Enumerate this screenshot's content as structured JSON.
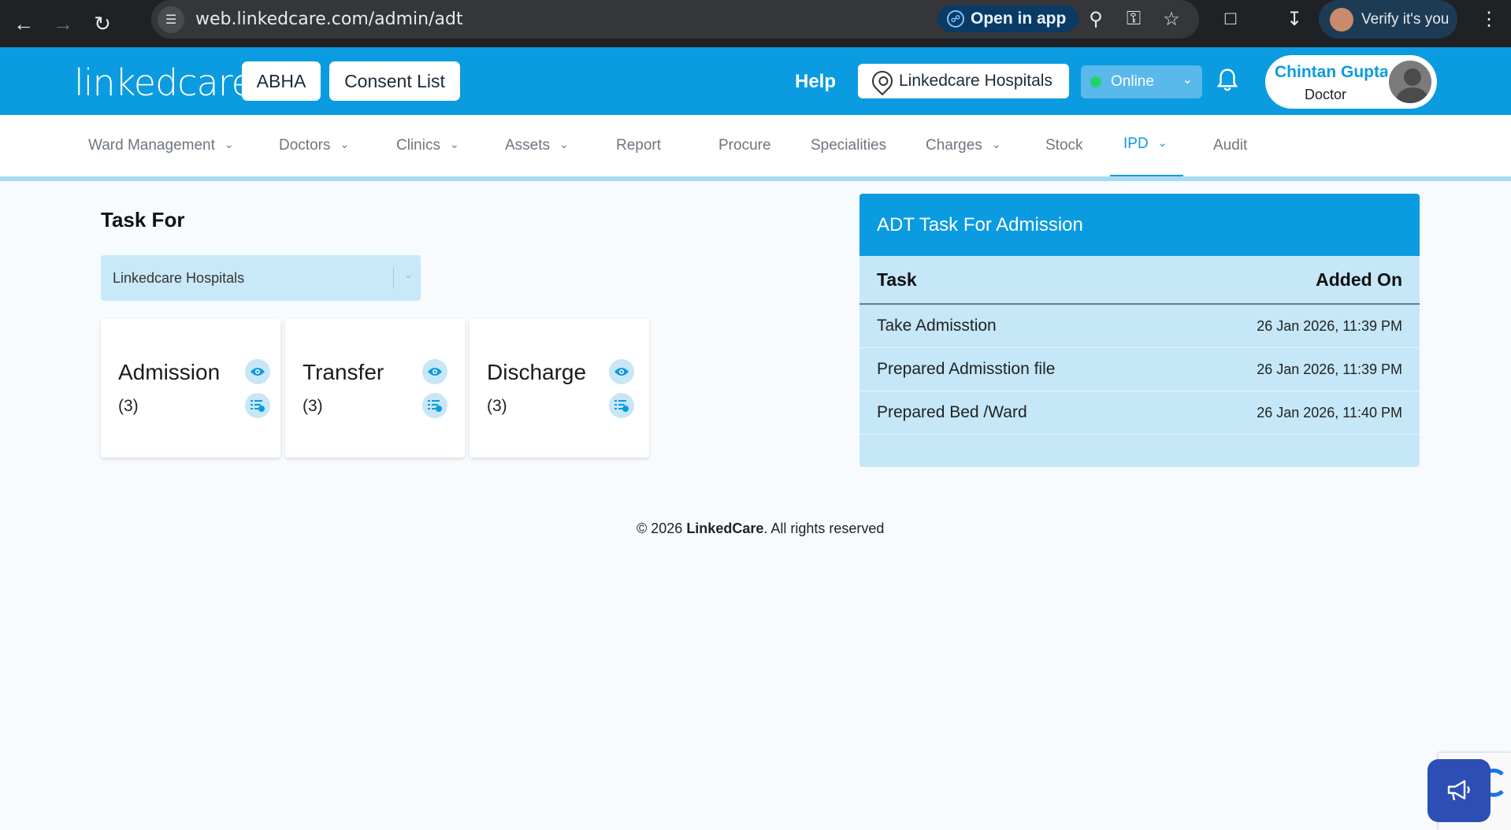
{
  "browser": {
    "url": "web.linkedcare.com/admin/adt",
    "open_in_app": "Open in app",
    "verify": "Verify it's you"
  },
  "header": {
    "logo": "linkedcare",
    "abha_button": "ABHA",
    "consent_button": "Consent List",
    "help": "Help",
    "location": "Linkedcare Hospitals",
    "status": "Online",
    "user_name": "Chintan Gupta",
    "user_role": "Doctor"
  },
  "nav": {
    "items": [
      {
        "label": "Ward Management",
        "dropdown": true
      },
      {
        "label": "Doctors",
        "dropdown": true
      },
      {
        "label": "Clinics",
        "dropdown": true
      },
      {
        "label": "Assets",
        "dropdown": true
      },
      {
        "label": "Report",
        "dropdown": false
      },
      {
        "label": "Procure",
        "dropdown": false
      },
      {
        "label": "Specialities",
        "dropdown": false
      },
      {
        "label": "Charges",
        "dropdown": true
      },
      {
        "label": "Stock",
        "dropdown": false
      },
      {
        "label": "IPD",
        "dropdown": true,
        "active": true
      },
      {
        "label": "Audit",
        "dropdown": false
      }
    ]
  },
  "task_for": {
    "title": "Task For",
    "selected": "Linkedcare Hospitals",
    "cards": [
      {
        "label": "Admission",
        "count": "(3)"
      },
      {
        "label": "Transfer",
        "count": "(3)"
      },
      {
        "label": "Discharge",
        "count": "(3)"
      }
    ]
  },
  "adt_panel": {
    "title": "ADT Task For Admission",
    "col_task": "Task",
    "col_added": "Added On",
    "rows": [
      {
        "task": "Take Admisstion",
        "added": "26 Jan 2026, 11:39 PM"
      },
      {
        "task": "Prepared Admisstion file",
        "added": "26 Jan 2026, 11:39 PM"
      },
      {
        "task": "Prepared Bed /Ward",
        "added": "26 Jan 2026, 11:40 PM"
      }
    ]
  },
  "footer": {
    "prefix": "© 2026 ",
    "brand": "LinkedCare",
    "suffix": ". All rights reserved"
  },
  "colors": {
    "primary": "#0b9be0",
    "light": "#c5e7f7",
    "online": "#24d26b"
  }
}
